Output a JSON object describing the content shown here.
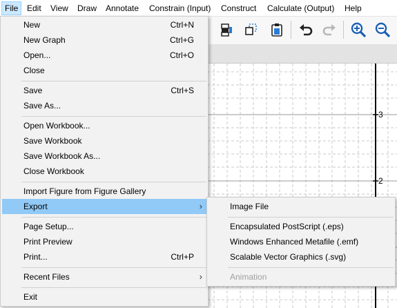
{
  "menubar": {
    "items": [
      "File",
      "Edit",
      "View",
      "Draw",
      "Annotate",
      "Constrain (Input)",
      "Construct",
      "Calculate (Output)",
      "Help"
    ]
  },
  "canvas": {
    "y_tick_labels": [
      "3",
      "2"
    ]
  },
  "file_menu": {
    "items": [
      {
        "label": "New",
        "shortcut": "Ctrl+N"
      },
      {
        "label": "New Graph",
        "shortcut": "Ctrl+G"
      },
      {
        "label": "Open...",
        "shortcut": "Ctrl+O"
      },
      {
        "label": "Close",
        "shortcut": ""
      },
      {
        "label": "Save",
        "shortcut": "Ctrl+S"
      },
      {
        "label": "Save As...",
        "shortcut": ""
      },
      {
        "label": "Open Workbook...",
        "shortcut": ""
      },
      {
        "label": "Save Workbook",
        "shortcut": ""
      },
      {
        "label": "Save Workbook As...",
        "shortcut": ""
      },
      {
        "label": "Close Workbook",
        "shortcut": ""
      },
      {
        "label": "Import Figure from Figure Gallery",
        "shortcut": ""
      },
      {
        "label": "Export",
        "shortcut": ""
      },
      {
        "label": "Page Setup...",
        "shortcut": ""
      },
      {
        "label": "Print Preview",
        "shortcut": ""
      },
      {
        "label": "Print...",
        "shortcut": "Ctrl+P"
      },
      {
        "label": "Recent Files",
        "shortcut": ""
      },
      {
        "label": "Exit",
        "shortcut": ""
      }
    ],
    "highlighted": "Export"
  },
  "export_menu": {
    "items": [
      {
        "label": "Image File"
      },
      {
        "label": "Encapsulated PostScript (.eps)"
      },
      {
        "label": "Windows Enhanced Metafile (.emf)"
      },
      {
        "label": "Scalable Vector Graphics (.svg)"
      },
      {
        "label": "Animation"
      }
    ],
    "disabled": "Animation"
  },
  "colors": {
    "highlight": "#91c9f7",
    "menubar_active": "#cce8ff",
    "zoom_icon": "#1a5fb4",
    "icon_dark": "#222222"
  }
}
